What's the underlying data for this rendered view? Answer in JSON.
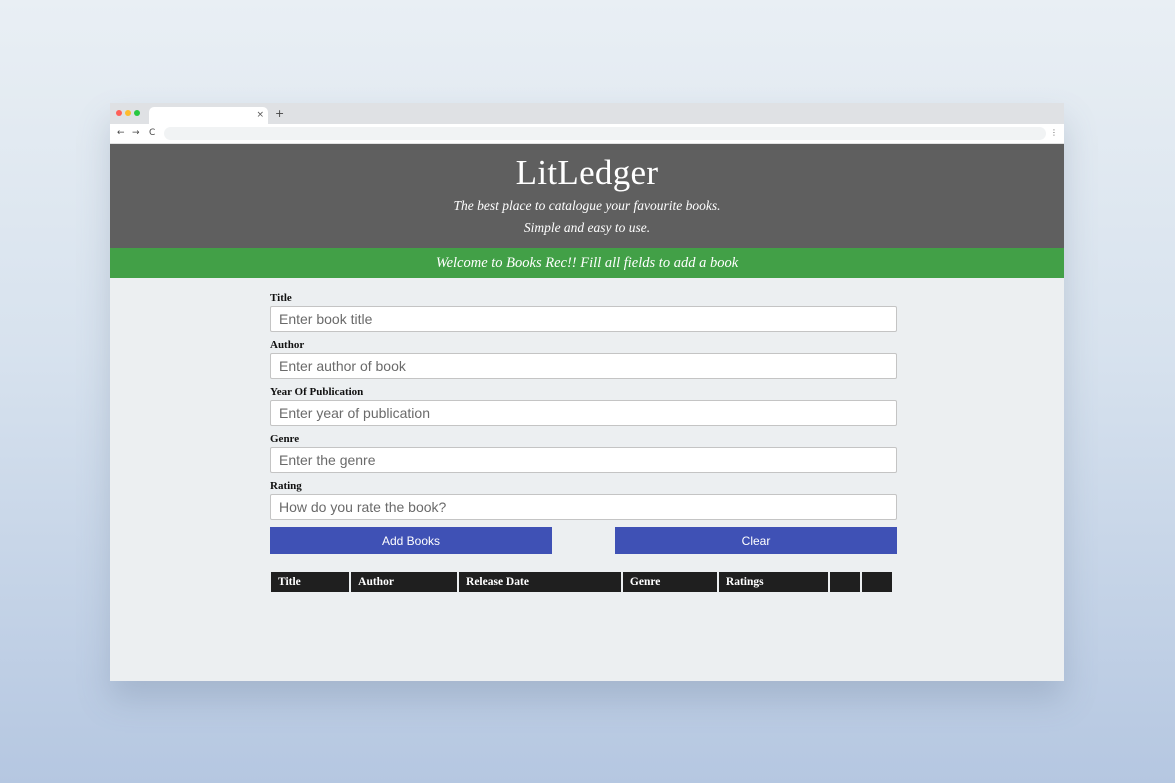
{
  "browser": {
    "tab_close": "×",
    "new_tab": "+",
    "nav_back": "←",
    "nav_forward": "→",
    "nav_reload": "C",
    "menu": "⋮"
  },
  "header": {
    "title": "LitLedger",
    "tagline_1": "The best place to catalogue your favourite books.",
    "tagline_2": "Simple and easy to use."
  },
  "banner": {
    "text": "Welcome to Books Rec!! Fill all fields to add a book"
  },
  "form": {
    "fields": [
      {
        "label": "Title",
        "placeholder": "Enter book title"
      },
      {
        "label": "Author",
        "placeholder": "Enter author of book"
      },
      {
        "label": "Year Of Publication",
        "placeholder": "Enter year of publication"
      },
      {
        "label": "Genre",
        "placeholder": "Enter the genre"
      },
      {
        "label": "Rating",
        "placeholder": "How do you rate the book?"
      }
    ],
    "add_label": "Add Books",
    "clear_label": "Clear"
  },
  "table": {
    "columns": [
      "Title",
      "Author",
      "Release Date",
      "Genre",
      "Ratings",
      "",
      ""
    ]
  },
  "colors": {
    "header_bg": "#5f5f5f",
    "banner_bg": "#42a047",
    "button_bg": "#3f51b5",
    "table_header_bg": "#1f1f1f"
  }
}
